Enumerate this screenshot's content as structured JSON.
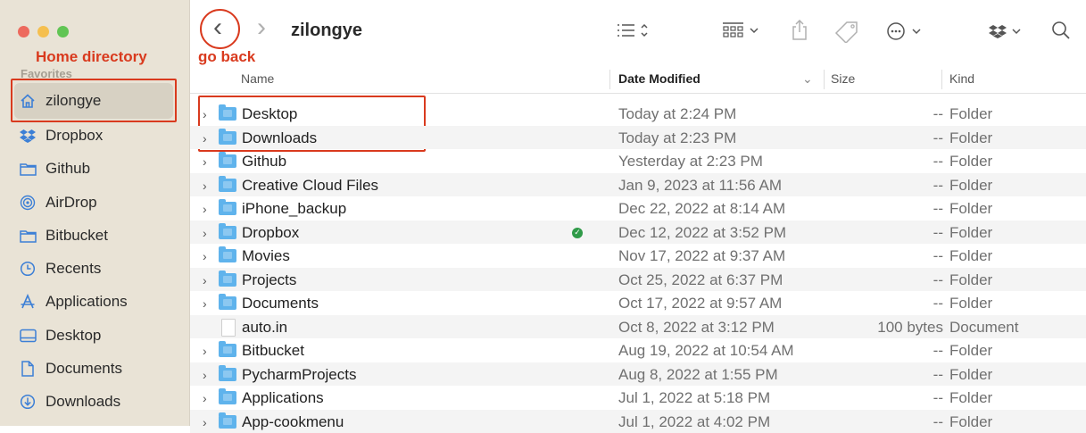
{
  "annotations": {
    "home_directory": "Home directory",
    "go_back": "go back"
  },
  "sidebar": {
    "section": "Favorites",
    "items": [
      {
        "label": "zilongye",
        "icon": "house-icon"
      },
      {
        "label": "Dropbox",
        "icon": "dropbox-icon"
      },
      {
        "label": "Github",
        "icon": "folder-icon"
      },
      {
        "label": "AirDrop",
        "icon": "airdrop-icon"
      },
      {
        "label": "Bitbucket",
        "icon": "folder-icon"
      },
      {
        "label": "Recents",
        "icon": "clock-icon"
      },
      {
        "label": "Applications",
        "icon": "applications-icon"
      },
      {
        "label": "Desktop",
        "icon": "desktop-icon"
      },
      {
        "label": "Documents",
        "icon": "document-icon"
      },
      {
        "label": "Downloads",
        "icon": "download-icon"
      }
    ]
  },
  "toolbar": {
    "title": "zilongye",
    "back_glyph": "‹",
    "forward_glyph": "›"
  },
  "columns": {
    "name": "Name",
    "date": "Date Modified",
    "size": "Size",
    "kind": "Kind"
  },
  "files": [
    {
      "name": "Desktop",
      "date": "Today at 2:24 PM",
      "size": "--",
      "kind": "Folder"
    },
    {
      "name": "Downloads",
      "date": "Today at 2:23 PM",
      "size": "--",
      "kind": "Folder"
    },
    {
      "name": "Github",
      "date": "Yesterday at 2:23 PM",
      "size": "--",
      "kind": "Folder"
    },
    {
      "name": "Creative Cloud Files",
      "date": "Jan 9, 2023 at 11:56 AM",
      "size": "--",
      "kind": "Folder"
    },
    {
      "name": "iPhone_backup",
      "date": "Dec 22, 2022 at 8:14 AM",
      "size": "--",
      "kind": "Folder"
    },
    {
      "name": "Dropbox",
      "date": "Dec 12, 2022 at 3:52 PM",
      "size": "--",
      "kind": "Folder"
    },
    {
      "name": "Movies",
      "date": "Nov 17, 2022 at 9:37 AM",
      "size": "--",
      "kind": "Folder"
    },
    {
      "name": "Projects",
      "date": "Oct 25, 2022 at 6:37 PM",
      "size": "--",
      "kind": "Folder"
    },
    {
      "name": "Documents",
      "date": "Oct 17, 2022 at 9:57 AM",
      "size": "--",
      "kind": "Folder"
    },
    {
      "name": "auto.in",
      "date": "Oct 8, 2022 at 3:12 PM",
      "size": "100 bytes",
      "kind": "Document"
    },
    {
      "name": "Bitbucket",
      "date": "Aug 19, 2022 at 10:54 AM",
      "size": "--",
      "kind": "Folder"
    },
    {
      "name": "PycharmProjects",
      "date": "Aug 8, 2022 at 1:55 PM",
      "size": "--",
      "kind": "Folder"
    },
    {
      "name": "Applications",
      "date": "Jul 1, 2022 at 5:18 PM",
      "size": "--",
      "kind": "Folder"
    },
    {
      "name": "App-cookmenu",
      "date": "Jul 1, 2022 at 4:02 PM",
      "size": "--",
      "kind": "Folder"
    }
  ],
  "colors": {
    "annotation": "#d93a1e",
    "folder": "#5fb3ec",
    "sidebar_bg": "#e9e3d6"
  }
}
